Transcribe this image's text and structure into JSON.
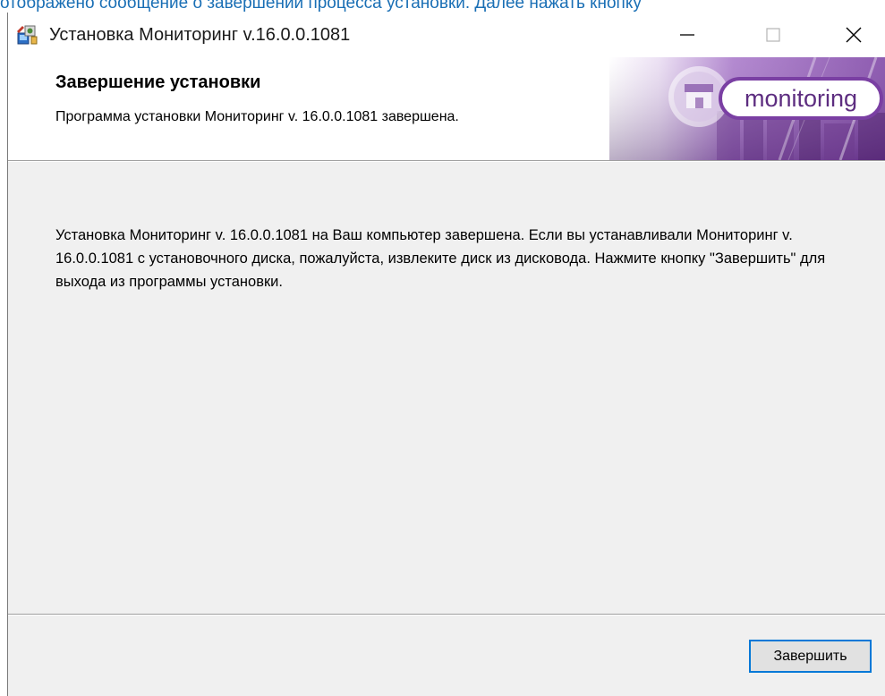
{
  "page": {
    "caption": "отображено сообщение о завершении процесса установки. Далее нажать кнопку"
  },
  "window": {
    "title": "Установка Мониторинг v.16.0.0.1081",
    "minimize_glyph": "—",
    "maximize_glyph": "☐",
    "close_glyph": "✕"
  },
  "header": {
    "title": "Завершение установки",
    "subtitle": "Программа установки Мониторинг v. 16.0.0.1081 завершена.",
    "banner_logo": "monitoring"
  },
  "main": {
    "message": "Установка Мониторинг v. 16.0.0.1081 на Ваш компьютер завершена. Если вы устанавливали Мониторинг v. 16.0.0.1081 с установочного диска, пожалуйста, извлеките диск из дисковода. Нажмите кнопку \"Завершить\" для выхода из программы установки."
  },
  "footer": {
    "finish_label": "Завершить"
  },
  "icons": {
    "app": "installer-icon",
    "minimize": "minimize-icon",
    "maximize": "maximize-icon",
    "close": "close-icon"
  },
  "colors": {
    "accent": "#0078d7",
    "banner_purple": "#8a4fb0",
    "caption_link": "#1a6fb5",
    "dialog_bg": "#f0f0f0"
  }
}
